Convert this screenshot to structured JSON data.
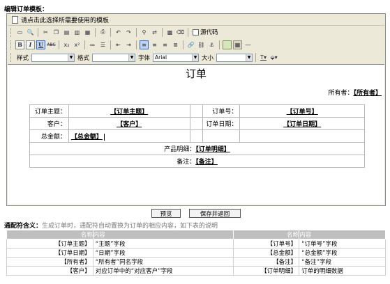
{
  "heading": "编辑订单模板：",
  "template_picker": "请点击此选择所需要使用的模板",
  "toolbar": {
    "source_code": "源代码",
    "style_label": "样式",
    "format_label": "格式",
    "font_label": "字体",
    "font_value": "Arial",
    "size_label": "大小"
  },
  "doc": {
    "title": "订单",
    "owner_label": "所有者：",
    "owner_field": "【所有者】",
    "rows": {
      "subject_label": "订单主题：",
      "subject_field": "【订单主题】",
      "number_label": "订单号：",
      "number_field": "【订单号】",
      "customer_label": "客户：",
      "customer_field": "【客户】",
      "date_label": "订单日期：",
      "date_field": "【订单日期】",
      "total_label": "总金额：",
      "total_field": "【总金额】",
      "detail_label": "产品明细：",
      "detail_field": "【订单明细】",
      "note_label": "备注：",
      "note_field": "【备注】"
    }
  },
  "buttons": {
    "preview": "预览",
    "save_return": "保存并返回"
  },
  "legend": {
    "title": "通配符含义：",
    "desc": "生成订单时，通配符自动置换为订单的相应内容，如下表的说明",
    "header_name": "名称",
    "header_content": "内容",
    "rows": [
      {
        "n1": "【订单主题】",
        "c1": "“主题”字段",
        "n2": "【订单号】",
        "c2": "“订单号”字段"
      },
      {
        "n1": "【订单日期】",
        "c1": "“日期”字段",
        "n2": "【总金额】",
        "c2": "“总金额”字段"
      },
      {
        "n1": "【所有者】",
        "c1": "“所有者”同名字段",
        "n2": "【备注】",
        "c2": "“备注”字段"
      },
      {
        "n1": "【客户】",
        "c1": "对应订单中的“对应客户”字段",
        "n2": "【订单明细】",
        "c2": "订单的明细数据"
      }
    ]
  },
  "icons": [
    "document-icon",
    "new-doc-icon",
    "preview-icon",
    "cut-icon",
    "copy-icon",
    "paste-icon",
    "paste-text-icon",
    "paste-word-icon",
    "print-icon",
    "undo-icon",
    "redo-icon",
    "find-icon",
    "replace-icon",
    "select-all-icon",
    "remove-format-icon",
    "source-icon",
    "bold-icon",
    "italic-icon",
    "underline-icon",
    "strike-icon",
    "subscript-icon",
    "superscript-icon",
    "ordered-list-icon",
    "unordered-list-icon",
    "outdent-icon",
    "indent-icon",
    "align-left-icon",
    "align-center-icon",
    "align-right-icon",
    "justify-icon",
    "link-icon",
    "unlink-icon",
    "anchor-icon",
    "image-icon",
    "table-icon",
    "rule-icon",
    "text-color-icon",
    "bg-color-icon"
  ]
}
